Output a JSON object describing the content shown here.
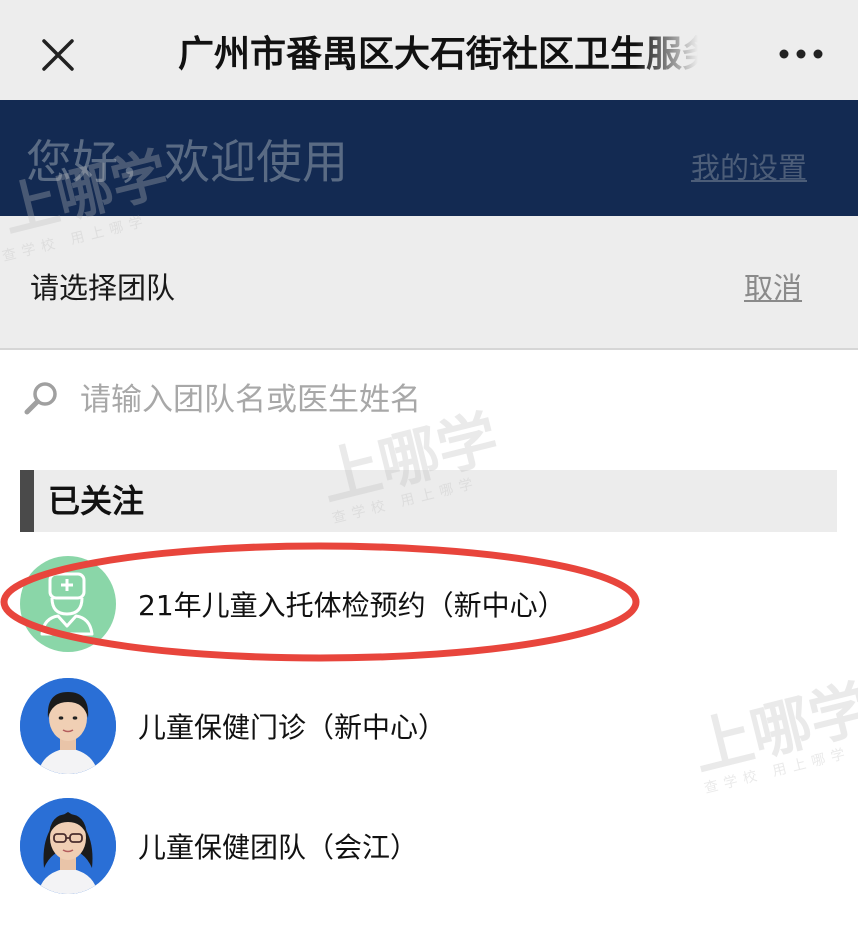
{
  "navbar": {
    "title": "广州市番禺区大石街社区卫生服务",
    "close_icon": "close-icon",
    "more_icon": "more-dots-icon"
  },
  "banner": {
    "greeting": "您好，欢迎使用",
    "settings_link": "我的设置"
  },
  "team_select": {
    "label": "请选择团队",
    "cancel": "取消"
  },
  "search": {
    "placeholder": "请输入团队名或医生姓名",
    "icon": "search-icon"
  },
  "followed_section": {
    "title": "已关注",
    "teams": [
      {
        "name": "21年儿童入托体检预约（新中心）",
        "avatar": "doctor-default-icon",
        "highlighted": true
      },
      {
        "name": "儿童保健门诊（新中心）",
        "avatar": "doctor-photo"
      },
      {
        "name": "儿童保健团队（会江）",
        "avatar": "doctor-photo-glasses"
      }
    ]
  },
  "watermark": {
    "text": "上哪学",
    "subtext": "查学校 用上哪学"
  },
  "colors": {
    "banner_bg": "#132a52",
    "highlight": "#e8453c",
    "default_avatar": "#8ad6a8",
    "photo_avatar_bg": "#2a6fd6"
  }
}
